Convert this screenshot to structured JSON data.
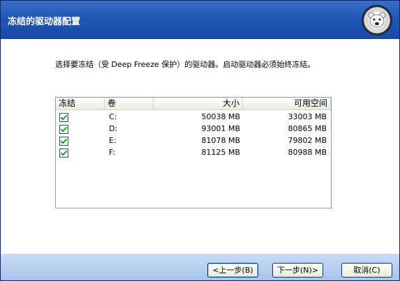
{
  "header": {
    "title": "冻结的驱动器配置"
  },
  "instruction": "选择要冻结（受 Deep Freeze 保护）的驱动器。启动驱动器必须始终冻结。",
  "columns": [
    "冻结",
    "卷",
    "大小",
    "可用空间"
  ],
  "rows": [
    {
      "checked": true,
      "volume": "C:",
      "size": "50038 MB",
      "free": "33003 MB"
    },
    {
      "checked": true,
      "volume": "D:",
      "size": "93001 MB",
      "free": "80865 MB"
    },
    {
      "checked": true,
      "volume": "E:",
      "size": "81078 MB",
      "free": "79802 MB"
    },
    {
      "checked": true,
      "volume": "F:",
      "size": "81125 MB",
      "free": "80988 MB"
    }
  ],
  "footer": {
    "back_label": "<上一步(B)",
    "next_label": "下一步(N)>",
    "cancel_label": "取消(C)"
  },
  "colors": {
    "header": "#1f57b7",
    "footer": "#a9c4ec",
    "check": "#21a121"
  },
  "icons": {
    "logo": "polar-bear-logo"
  }
}
